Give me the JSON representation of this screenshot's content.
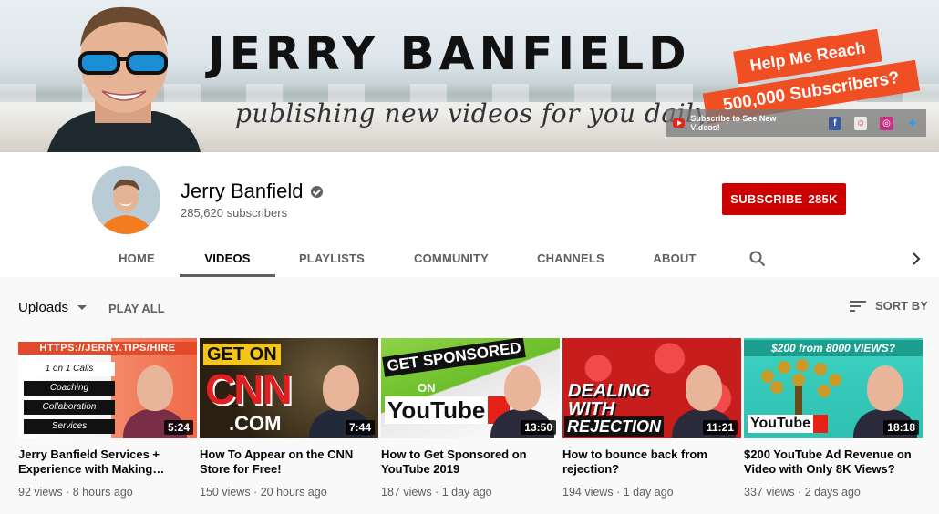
{
  "banner": {
    "title": "JERRY BANFIELD",
    "subtitle": "publishing new videos for you daily",
    "help_text": "Help Me Reach",
    "goal_text": "500,000 Subscribers?",
    "social_text": "Subscribe to See New Videos!",
    "social_icons": [
      "facebook-icon",
      "profile-icon",
      "instagram-icon",
      "twitter-icon"
    ]
  },
  "channel": {
    "name": "Jerry Banfield",
    "subscribers": "285,620 subscribers",
    "subscribe_label": "SUBSCRIBE",
    "subscribe_count": "285K"
  },
  "tabs": [
    {
      "label": "HOME",
      "active": false
    },
    {
      "label": "VIDEOS",
      "active": true
    },
    {
      "label": "PLAYLISTS",
      "active": false
    },
    {
      "label": "COMMUNITY",
      "active": false
    },
    {
      "label": "CHANNELS",
      "active": false
    },
    {
      "label": "ABOUT",
      "active": false
    }
  ],
  "controls": {
    "uploads": "Uploads",
    "play_all": "PLAY ALL",
    "sort_by": "SORT BY"
  },
  "videos": [
    {
      "title": "Jerry Banfield Services + Experience with Making…",
      "meta": "92 views · 8 hours ago",
      "duration": "5:24",
      "thumb_text": [
        "HTTPS://JERRY.TIPS/HIRE",
        "1 on 1 Calls",
        "Coaching",
        "Collaboration",
        "Services"
      ]
    },
    {
      "title": "How To Appear on the CNN Store for Free!",
      "meta": "150 views · 20 hours ago",
      "duration": "7:44",
      "thumb_text": [
        "GET ON",
        "CNN",
        ".COM"
      ]
    },
    {
      "title": "How to Get Sponsored on YouTube 2019",
      "meta": "187 views · 1 day ago",
      "duration": "13:50",
      "thumb_text": [
        "GET SPONSORED",
        "ON",
        "YouTube"
      ]
    },
    {
      "title": "How to bounce back from rejection?",
      "meta": "194 views · 1 day ago",
      "duration": "11:21",
      "thumb_text": [
        "DEALING",
        "WITH",
        "REJECTION"
      ]
    },
    {
      "title": "$200 YouTube Ad Revenue on Video with Only 8K Views?",
      "meta": "337 views · 2 days ago",
      "duration": "18:18",
      "thumb_text": [
        "$200 from 8000 VIEWS?",
        "YouTube"
      ]
    }
  ],
  "colors": {
    "subscribe_red": "#cc0000",
    "banner_orange": "#f04e23",
    "text_secondary": "#606060"
  }
}
